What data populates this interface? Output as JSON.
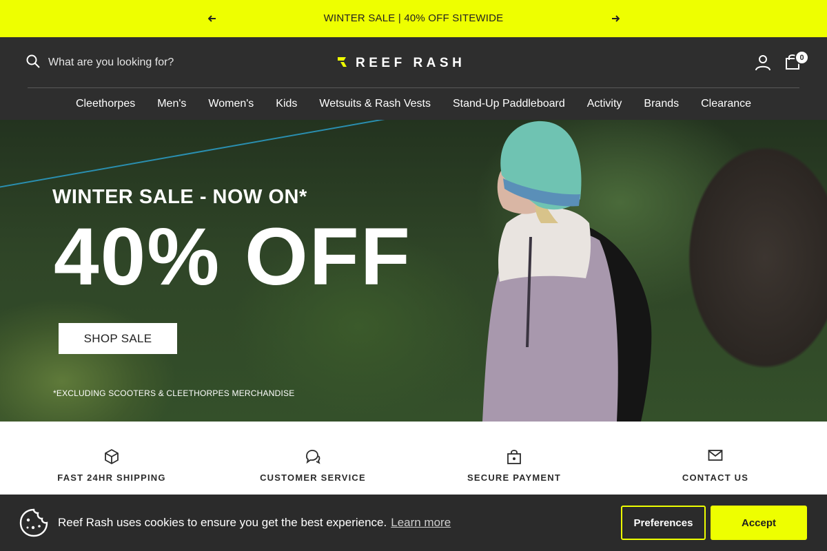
{
  "announcement": {
    "text": "WINTER SALE | 40% OFF SITEWIDE",
    "prev_icon": "arrow-left-icon",
    "next_icon": "arrow-right-icon"
  },
  "header": {
    "search_placeholder": "What are you looking for?",
    "logo_text": "REEF RASH",
    "cart_count": "0"
  },
  "nav": {
    "items": [
      {
        "label": "Cleethorpes"
      },
      {
        "label": "Men's"
      },
      {
        "label": "Women's"
      },
      {
        "label": "Kids"
      },
      {
        "label": "Wetsuits & Rash Vests"
      },
      {
        "label": "Stand-Up Paddleboard"
      },
      {
        "label": "Activity"
      },
      {
        "label": "Brands"
      },
      {
        "label": "Clearance"
      }
    ]
  },
  "hero": {
    "eyebrow": "WINTER SALE - NOW ON*",
    "headline": "40% OFF",
    "cta": "SHOP SALE",
    "fine_print": "*EXCLUDING SCOOTERS & CLEETHORPES MERCHANDISE"
  },
  "features": [
    {
      "label": "FAST 24HR SHIPPING",
      "icon": "box-icon"
    },
    {
      "label": "CUSTOMER SERVICE",
      "icon": "chat-icon"
    },
    {
      "label": "SECURE PAYMENT",
      "icon": "lock-bag-icon"
    },
    {
      "label": "CONTACT US",
      "icon": "mail-icon"
    }
  ],
  "cookie": {
    "message": "Reef Rash uses cookies to ensure you get the best experience.",
    "learn_more": "Learn more",
    "preferences": "Preferences",
    "accept": "Accept"
  },
  "colors": {
    "accent": "#eeff00",
    "header_bg": "#2e2e2e",
    "cookie_bg": "#2b2b2b"
  }
}
